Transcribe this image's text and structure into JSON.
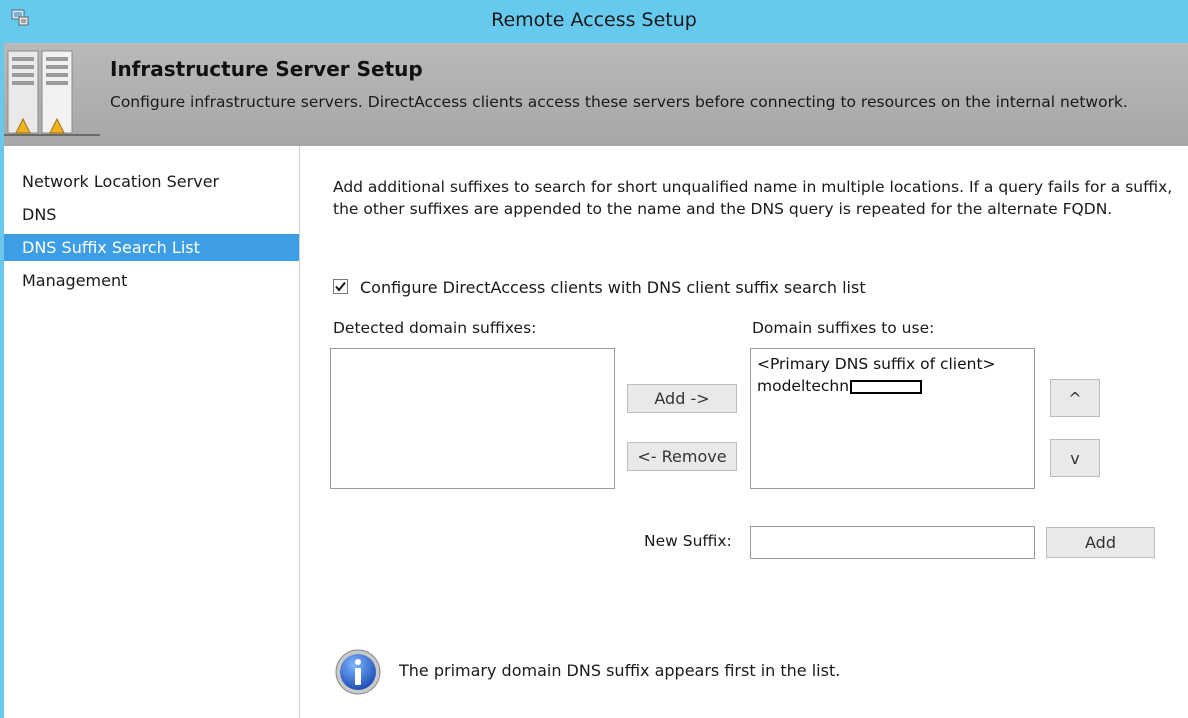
{
  "window": {
    "title": "Remote Access Setup"
  },
  "header": {
    "title": "Infrastructure Server Setup",
    "description": "Configure infrastructure servers. DirectAccess clients access these servers before connecting to resources on the internal network."
  },
  "nav": {
    "items": [
      {
        "label": "Network Location Server"
      },
      {
        "label": "DNS"
      },
      {
        "label": "DNS Suffix Search List",
        "selected": true
      },
      {
        "label": "Management"
      }
    ]
  },
  "main": {
    "description": "Add additional suffixes to search for short unqualified name in multiple locations. If a query fails for a suffix, the other suffixes are appended to the name and the DNS query is repeated for the alternate FQDN.",
    "checkbox": {
      "label": "Configure DirectAccess clients with DNS client suffix search list",
      "checked": true
    },
    "detected_label": "Detected domain suffixes:",
    "detected_items": [],
    "use_label": "Domain suffixes to use:",
    "use_items": [
      "<Primary DNS suffix of client>",
      "modeltechn"
    ],
    "add_button": "Add ->",
    "remove_button": "<- Remove",
    "move_up_button": "^",
    "move_down_button": "v",
    "new_suffix_label": "New Suffix:",
    "new_suffix_value": "",
    "new_suffix_add_button": "Add",
    "info_text": "The primary domain DNS suffix appears first in the list."
  },
  "colors": {
    "titlebar": "#66c9ee",
    "selection": "#3d9ee6",
    "header_bg": "#b0b0b0"
  }
}
